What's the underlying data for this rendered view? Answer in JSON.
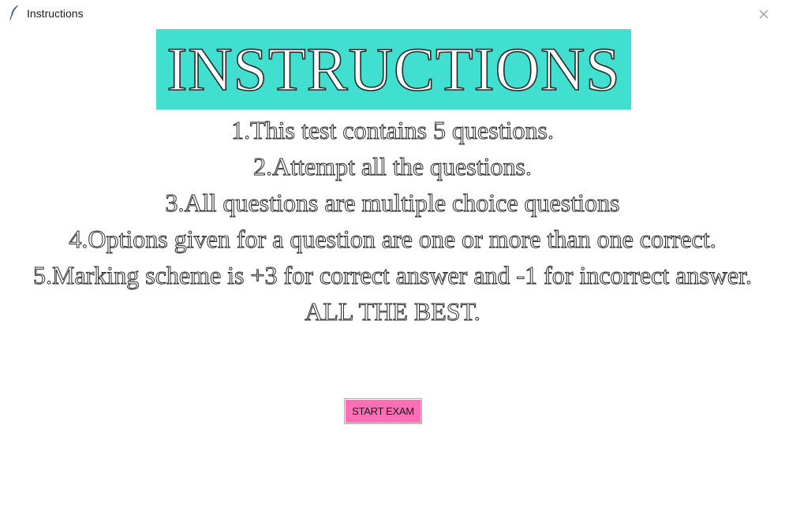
{
  "window": {
    "title": "Instructions",
    "app_icon": "feather-icon",
    "close_icon": "close-icon"
  },
  "heading": {
    "text": "INSTRUCTIONS",
    "background_color": "#40dfcf"
  },
  "instructions": [
    "1.This test contains 5 questions.",
    "2.Attempt all the questions.",
    "3.All questions are multiple choice questions",
    "4.Options given for a question are one or more than one correct.",
    "5.Marking scheme is +3 for correct answer and -1 for incorrect answer.",
    "ALL THE BEST."
  ],
  "start_button": {
    "label": "START EXAM",
    "background_color": "#ff6fb8"
  }
}
